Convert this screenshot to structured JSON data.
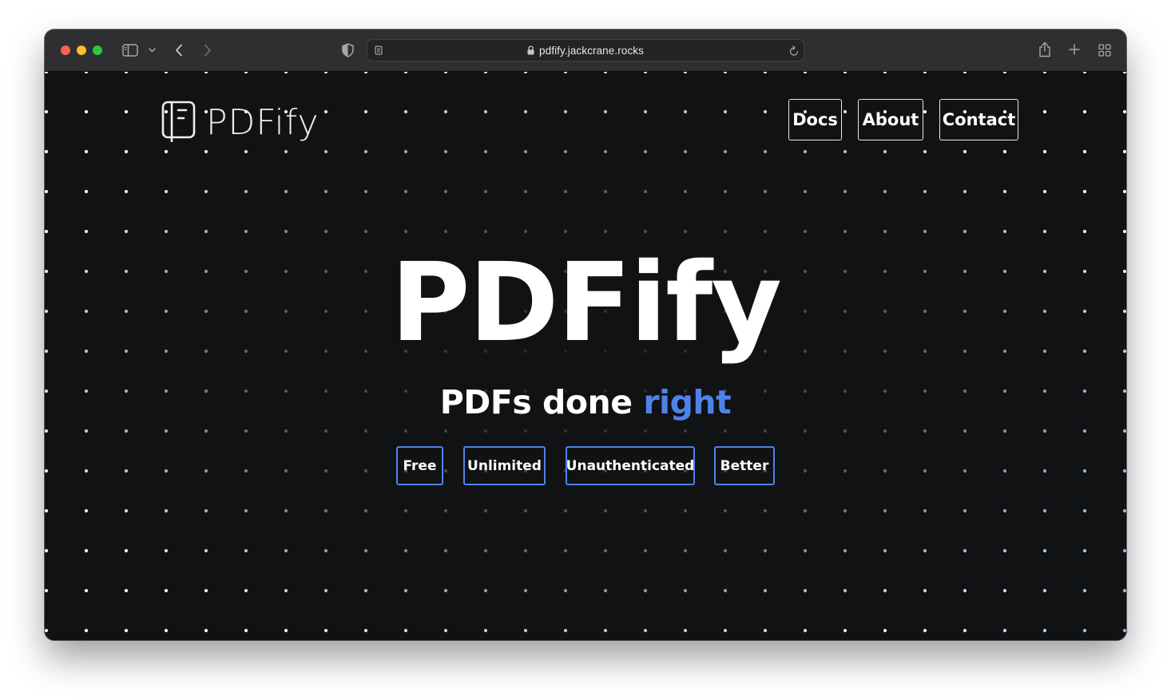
{
  "browser": {
    "url": "pdfify.jackcrane.rocks"
  },
  "site": {
    "logo_text": "PDFify",
    "nav": [
      {
        "label": "Docs"
      },
      {
        "label": "About"
      },
      {
        "label": "Contact"
      }
    ],
    "hero_title": "PDFify",
    "tagline_main": "PDFs done ",
    "tagline_accent": "right",
    "features": [
      {
        "label": "Free"
      },
      {
        "label": "Unlimited"
      },
      {
        "label": "Unauthenticated"
      },
      {
        "label": "Better"
      }
    ]
  },
  "colors": {
    "background": "#111214",
    "accent": "#4f82e9",
    "text": "#ffffff"
  }
}
